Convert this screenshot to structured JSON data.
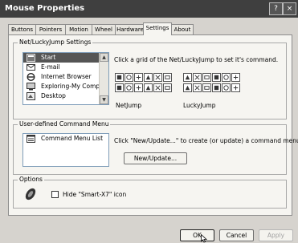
{
  "window": {
    "title": "Mouse Properties",
    "help_glyph": "?",
    "close_glyph": "×"
  },
  "tabs": [
    {
      "label": "Buttons"
    },
    {
      "label": "Pointers"
    },
    {
      "label": "Motion"
    },
    {
      "label": "Wheel"
    },
    {
      "label": "Hardware"
    },
    {
      "label": "Settings"
    },
    {
      "label": "About"
    }
  ],
  "active_tab": "Settings",
  "netlucky": {
    "legend": "Net/LuckyJump Settings",
    "items": [
      {
        "label": "Start",
        "icon": "start-icon"
      },
      {
        "label": "E-mail",
        "icon": "email-icon"
      },
      {
        "label": "Internet Browser",
        "icon": "browser-icon"
      },
      {
        "label": "Exploring-My Computer",
        "icon": "computer-icon"
      },
      {
        "label": "Desktop",
        "icon": "desktop-icon"
      }
    ],
    "selected_item": "Start",
    "hint": "Click a grid of the Net/LuckyJump to set it's command.",
    "netjump_label": "NetJump",
    "luckyjump_label": "LuckyJump"
  },
  "user_menu": {
    "legend": "User-defined Command Menu",
    "list_item": "Command Menu List",
    "hint": "Click \"New/Update...\" to create (or update) a command menu.",
    "new_button": "New/Update..."
  },
  "options": {
    "legend": "Options",
    "hide_checkbox_label": "Hide \"Smart-X7\" icon",
    "hide_checked": false
  },
  "footer": {
    "ok": "OK",
    "cancel": "Cancel",
    "apply": "Apply"
  }
}
